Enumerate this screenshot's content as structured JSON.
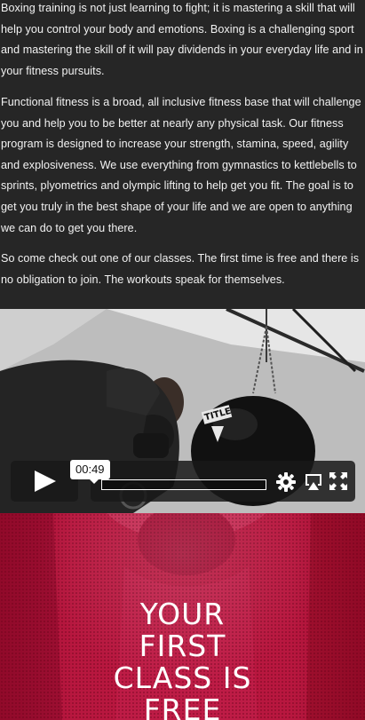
{
  "content": {
    "paragraphs": [
      "Boxing training is not just learning to fight; it is mastering a skill that will help you control your body and emotions. Boxing is a challenging sport and mastering the skill of it will pay dividends in your everyday life and in your fitness pursuits.",
      "Functional fitness is a broad, all inclusive fitness base that will challenge you and help you to be better at nearly any physical task. Our fitness program is designed to increase your strength, stamina, speed, agility and explosiveness. We use everything from gymnastics to kettlebells to sprints, plyometrics and olympic lifting to help get you fit. The goal is to get you truly in the best shape of your life and we are open to anything we can do to get you there.",
      "So come check out one of our classes. The first time is free and there is no obligation to join. The workouts speak for themselves."
    ]
  },
  "video": {
    "time_label": "00:49",
    "progress": 0,
    "bag_brand": "TITLE",
    "icons": [
      "play-icon",
      "settings-icon",
      "airplay-icon",
      "fullscreen-icon"
    ]
  },
  "promo": {
    "title_lines": [
      "YOUR",
      "FIRST",
      "CLASS IS",
      "FREE"
    ]
  },
  "colors": {
    "page_bg": "#262626",
    "promo_bg": "#b5153f",
    "control_bg": "#191919"
  }
}
